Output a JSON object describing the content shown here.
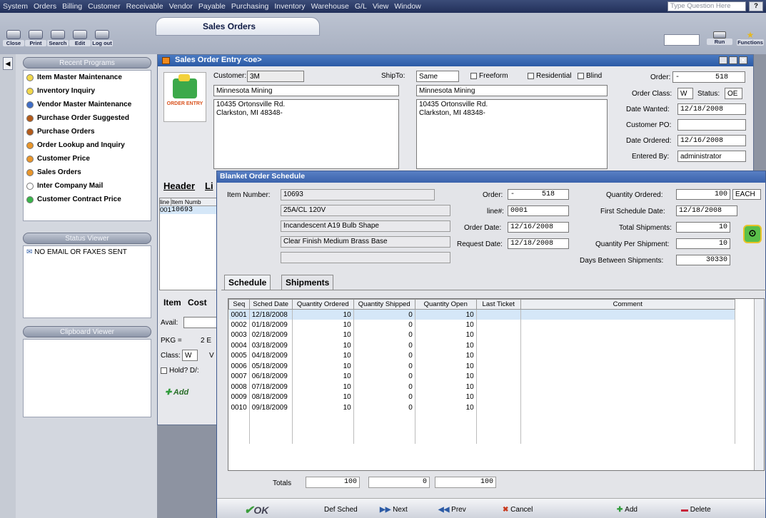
{
  "menu": [
    "System",
    "Orders",
    "Billing",
    "Customer",
    "Receivable",
    "Vendor",
    "Payable",
    "Purchasing",
    "Inventory",
    "Warehouse",
    "G/L",
    "View",
    "Window"
  ],
  "question_placeholder": "Type Question Here",
  "help_label": "?",
  "toolbar": [
    "Close",
    "Print",
    "Search",
    "Edit",
    "Log out"
  ],
  "top_tab": "Sales Orders",
  "run_label": "Run",
  "funct_label": "Functions",
  "left": {
    "recent_title": "Recent Programs",
    "programs": [
      {
        "label": "Item Master Maintenance",
        "color": "#f2d84a"
      },
      {
        "label": "Inventory Inquiry",
        "color": "#f2d84a"
      },
      {
        "label": "Vendor Master Maintenance",
        "color": "#3f6ec7"
      },
      {
        "label": "Purchase Order Suggested",
        "color": "#b45b1a"
      },
      {
        "label": "Purchase Orders",
        "color": "#b45b1a"
      },
      {
        "label": "Order Lookup and Inquiry",
        "color": "#e9962b"
      },
      {
        "label": "Customer Price",
        "color": "#e9962b"
      },
      {
        "label": "Sales Orders",
        "color": "#e9962b"
      },
      {
        "label": "Inter Company Mail",
        "color": "#ffffff"
      },
      {
        "label": "Customer Contract Price",
        "color": "#39b54a"
      }
    ],
    "status_title": "Status Viewer",
    "status_msg": "NO EMAIL OR FAXES SENT",
    "clipboard_title": "Clipboard Viewer"
  },
  "soe": {
    "title": "Sales Order Entry <oe>",
    "order_entry_logo": "ORDER ENTRY",
    "customer_label": "Customer:",
    "customer": "3M",
    "shipto_label": "ShipTo:",
    "shipto": "Same",
    "freeform": "Freeform",
    "residential": "Residential",
    "blind": "Blind",
    "bill_name": "Minnesota Mining",
    "bill_addr1": "10435 Ortonsville Rd.",
    "bill_addr2": "Clarkston, MI 48348-",
    "ship_name": "Minnesota Mining",
    "ship_addr1": "10435 Ortonsville Rd.",
    "ship_addr2": "Clarkston, MI 48348-",
    "order_label": "Order:",
    "order_prefix": "-",
    "order_no": "518",
    "order_class_label": "Order Class:",
    "order_class": "W",
    "status_label": "Status:",
    "status": "OE",
    "date_wanted_label": "Date Wanted:",
    "date_wanted": "12/18/2008",
    "customer_po_label": "Customer PO:",
    "date_ordered_label": "Date Ordered:",
    "date_ordered": "12/16/2008",
    "entered_by_label": "Entered By:",
    "entered_by": "administrator",
    "header_tab": "Header",
    "lines_tab": "Li",
    "grid_col1": "line",
    "grid_col2": "Item Numb",
    "grid_line": "001",
    "grid_item": "10693",
    "item_tab": "Item",
    "cost_tab": "Cost",
    "avail_label": "Avail:",
    "pkg_label": "PKG =",
    "pkg_val": "2 E",
    "class_label": "Class:",
    "class_val": "W",
    "class_extra": "V",
    "hold_label": "Hold? D/:",
    "add_label": "Add"
  },
  "bos": {
    "title": "Blanket Order Schedule",
    "item_number_label": "Item Number:",
    "item_number": "10693",
    "desc1": "25A/CL 120V",
    "desc2": "Incandescent A19 Bulb Shape",
    "desc3": "Clear Finish Medium Brass Base",
    "order_label": "Order:",
    "order_prefix": "-",
    "order_no": "518",
    "line_label": "line#:",
    "line_no": "0001",
    "order_date_label": "Order Date:",
    "order_date": "12/16/2008",
    "request_date_label": "Request Date:",
    "request_date": "12/18/2008",
    "qty_ordered_label": "Quantity Ordered:",
    "qty_ordered": "100",
    "unit": "EACH",
    "first_sched_label": "First Schedule Date:",
    "first_sched": "12/18/2008",
    "total_ship_label": "Total Shipments:",
    "total_ship": "10",
    "qty_per_ship_label": "Quantity Per Shipment:",
    "qty_per_ship": "10",
    "days_between_label": "Days Between Shipments:",
    "days_between": "30330",
    "tab_schedule": "Schedule",
    "tab_shipments": "Shipments",
    "columns": [
      "Seq",
      "Sched Date",
      "Quantity Ordered",
      "Quantity Shipped",
      "Quantity Open",
      "Last Ticket",
      "Comment"
    ],
    "rows": [
      [
        "0001",
        "12/18/2008",
        "10",
        "0",
        "10",
        "",
        ""
      ],
      [
        "0002",
        "01/18/2009",
        "10",
        "0",
        "10",
        "",
        ""
      ],
      [
        "0003",
        "02/18/2009",
        "10",
        "0",
        "10",
        "",
        ""
      ],
      [
        "0004",
        "03/18/2009",
        "10",
        "0",
        "10",
        "",
        ""
      ],
      [
        "0005",
        "04/18/2009",
        "10",
        "0",
        "10",
        "",
        ""
      ],
      [
        "0006",
        "05/18/2009",
        "10",
        "0",
        "10",
        "",
        ""
      ],
      [
        "0007",
        "06/18/2009",
        "10",
        "0",
        "10",
        "",
        ""
      ],
      [
        "0008",
        "07/18/2009",
        "10",
        "0",
        "10",
        "",
        ""
      ],
      [
        "0009",
        "08/18/2009",
        "10",
        "0",
        "10",
        "",
        ""
      ],
      [
        "0010",
        "09/18/2009",
        "10",
        "0",
        "10",
        "",
        ""
      ]
    ],
    "totals_label": "Totals",
    "total_ordered": "100",
    "total_shipped": "0",
    "total_open": "100",
    "ok_label": "OK",
    "def_sched_label": "Def Sched",
    "next_label": "Next",
    "prev_label": "Prev",
    "cancel_label": "Cancel",
    "add_label": "Add",
    "delete_label": "Delete"
  }
}
